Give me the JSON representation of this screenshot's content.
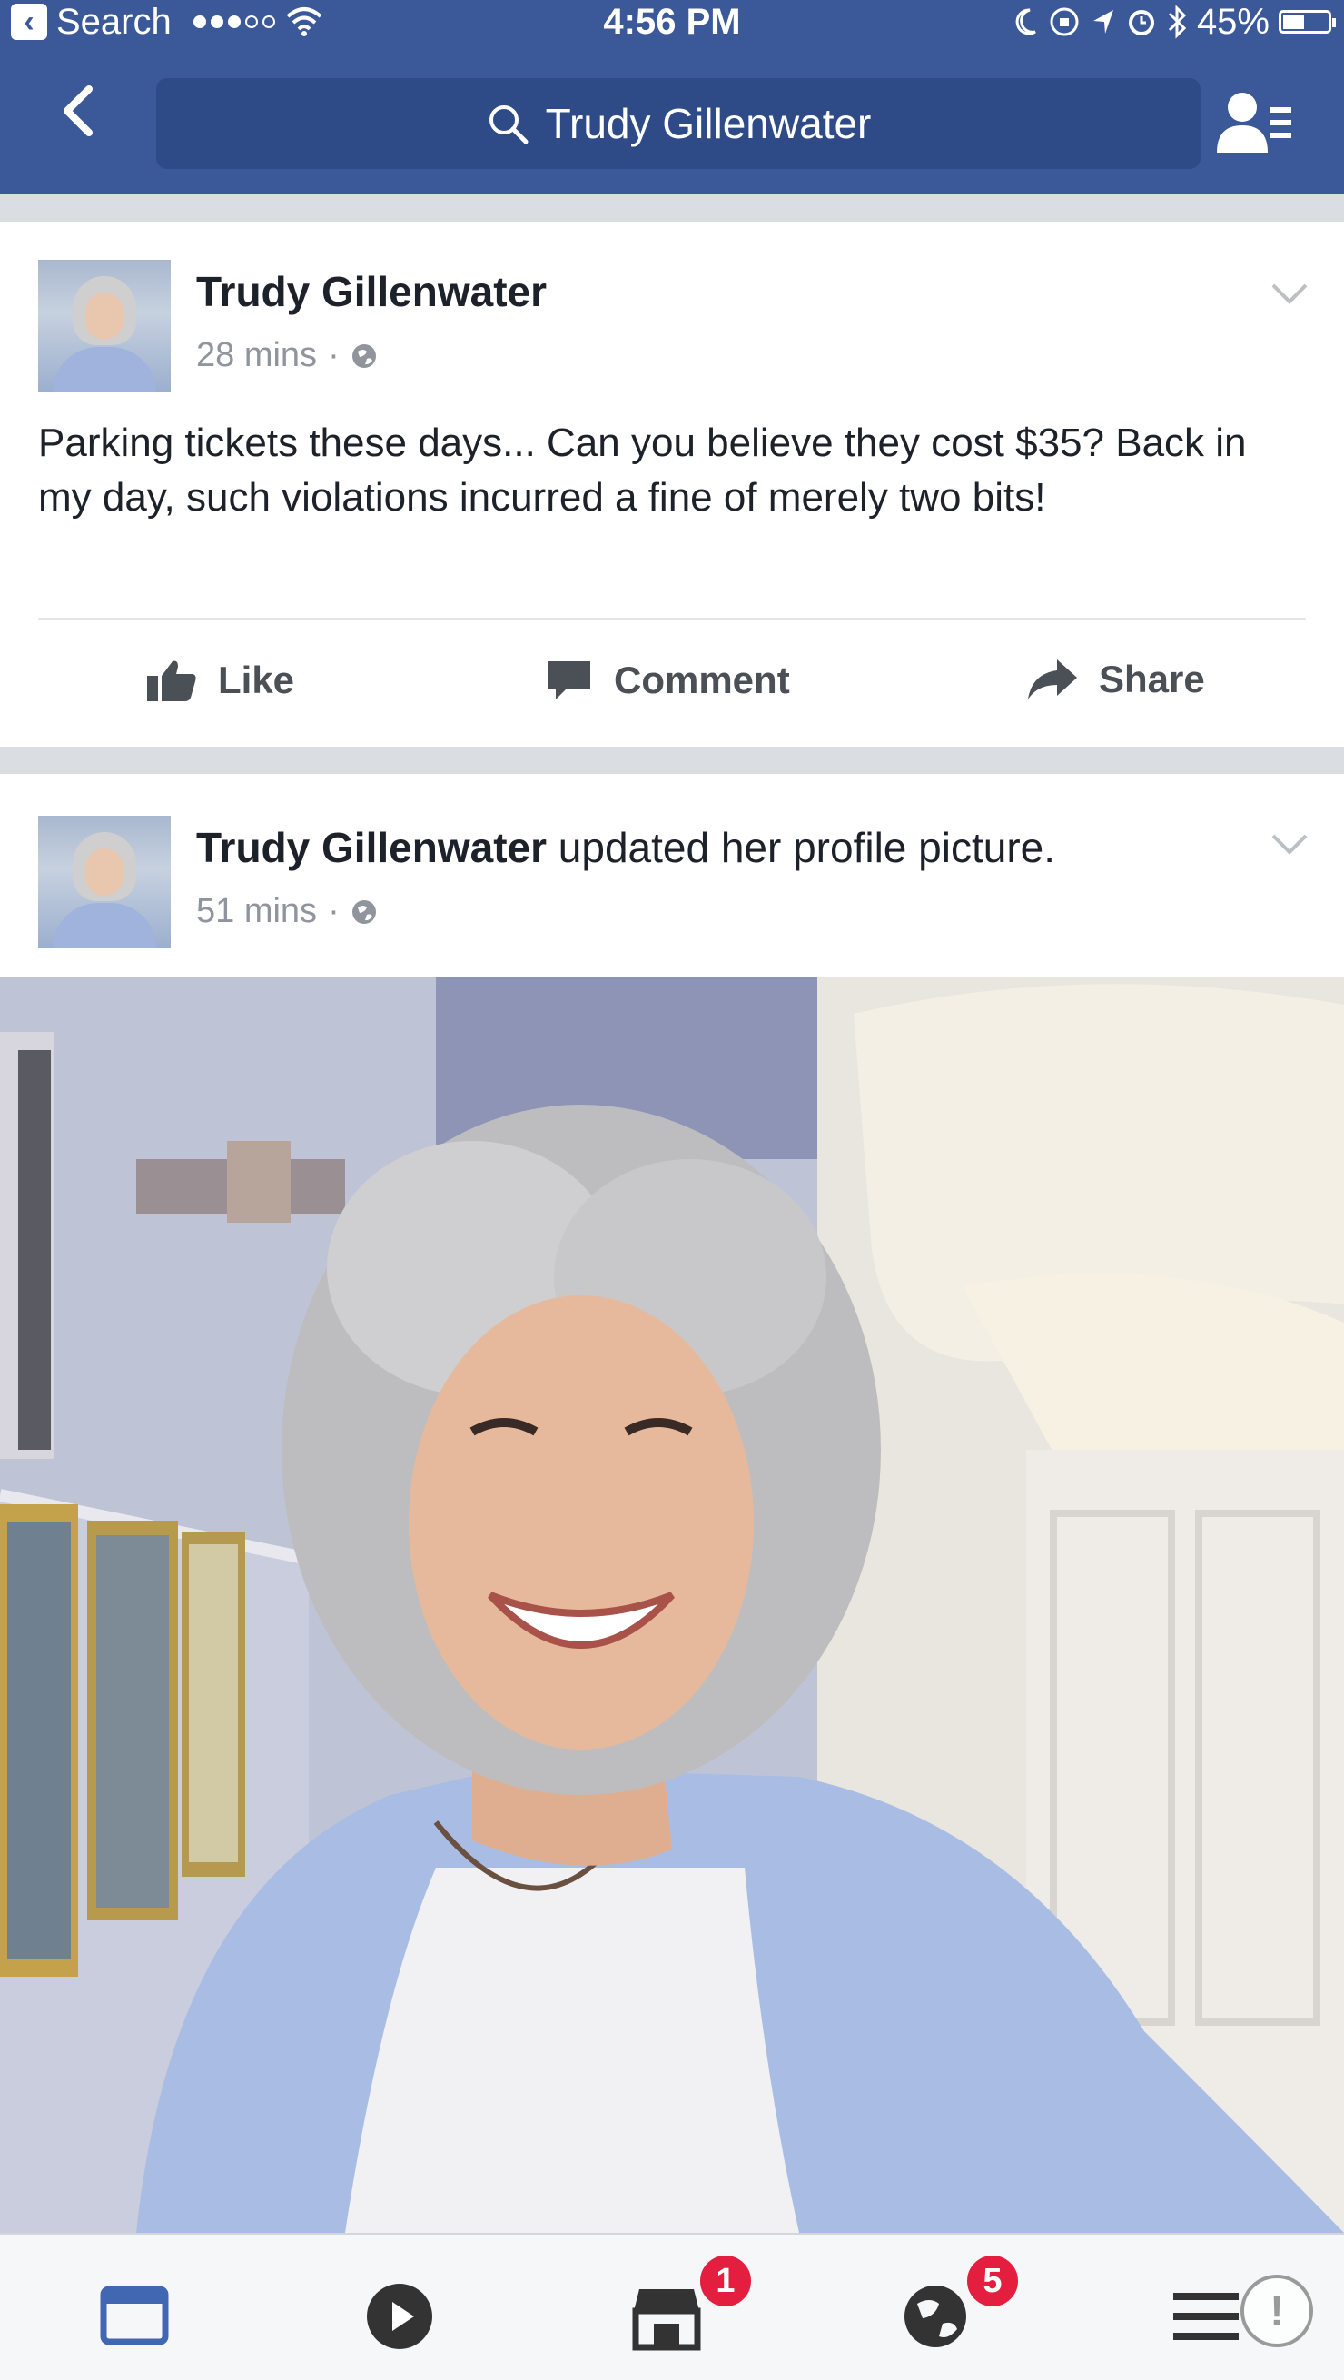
{
  "status_bar": {
    "back_app_label": "Search",
    "time": "4:56 PM",
    "battery": "45%",
    "signal_dots_filled": 3,
    "signal_dots_total": 5
  },
  "nav": {
    "search_text": "Trudy Gillenwater",
    "back_icon": "chevron-left-icon",
    "search_icon": "search-icon",
    "friends_icon": "friend-requests-icon"
  },
  "posts": [
    {
      "author": "Trudy Gillenwater",
      "time": "28 mins",
      "separator": "·",
      "privacy_icon": "globe-icon",
      "text": "Parking tickets these days... Can you believe they cost $35? Back in my day, such violations incurred a fine of merely two bits!",
      "actions": {
        "like": "Like",
        "comment": "Comment",
        "share": "Share"
      }
    },
    {
      "author": "Trudy Gillenwater",
      "activity": " updated her profile picture.",
      "time": "51 mins",
      "separator": "·",
      "privacy_icon": "globe-icon"
    }
  ],
  "tabbar": {
    "tabs": [
      {
        "name": "news-feed-icon",
        "badge": ""
      },
      {
        "name": "video-icon",
        "badge": ""
      },
      {
        "name": "marketplace-icon",
        "badge": "1"
      },
      {
        "name": "notifications-globe-icon",
        "badge": "5"
      },
      {
        "name": "menu-icon",
        "badge": ""
      }
    ],
    "assistive_label": "!"
  },
  "colors": {
    "brand": "#3b5998",
    "search_bg": "#2f4b87",
    "badge": "#e41e3f",
    "active_tab": "#4267b2"
  }
}
